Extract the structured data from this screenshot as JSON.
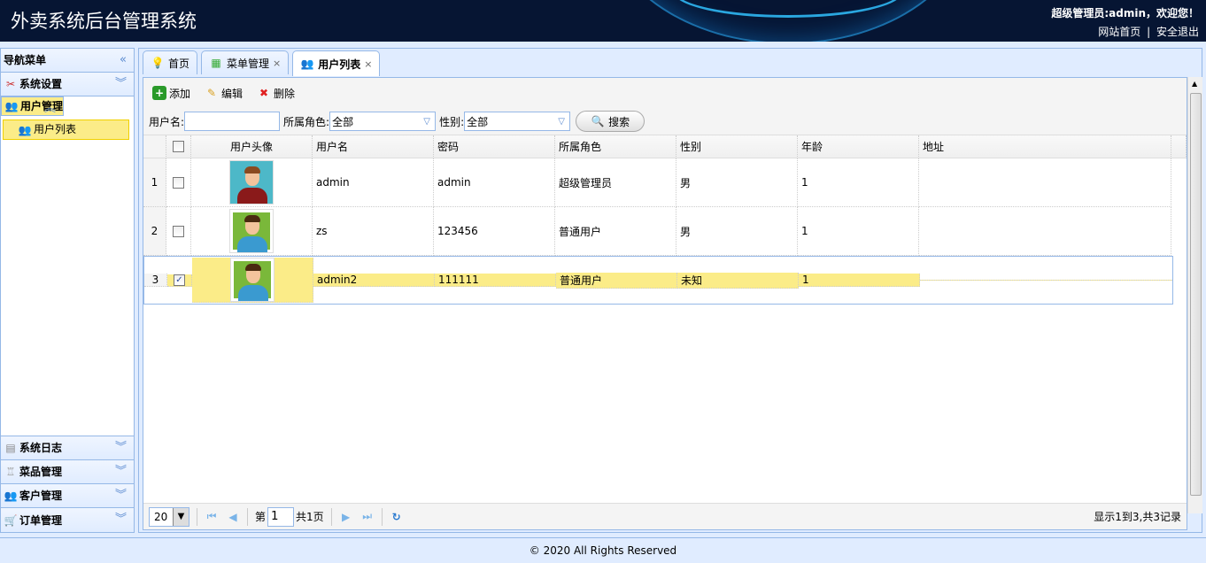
{
  "header": {
    "title": "外卖系统后台管理系统",
    "welcome": "超级管理员:admin，欢迎您！",
    "home_link": "网站首页",
    "separator": "|",
    "logout_link": "安全退出"
  },
  "sidebar": {
    "title": "导航菜单",
    "sections": [
      {
        "label": "系统设置"
      },
      {
        "label": "用户管理",
        "items": [
          {
            "label": "用户列表"
          }
        ]
      },
      {
        "label": "系统日志"
      },
      {
        "label": "菜品管理"
      },
      {
        "label": "客户管理"
      },
      {
        "label": "订单管理"
      }
    ]
  },
  "tabs": [
    {
      "label": "首页"
    },
    {
      "label": "菜单管理",
      "close": "×"
    },
    {
      "label": "用户列表",
      "close": "×"
    }
  ],
  "toolbar": {
    "add": "添加",
    "edit": "编辑",
    "delete": "删除"
  },
  "search": {
    "username_label": "用户名:",
    "username_value": "",
    "role_label": "所属角色:",
    "role_value": "全部",
    "gender_label": "性别:",
    "gender_value": "全部",
    "search_button": "搜索"
  },
  "grid": {
    "columns": [
      "用户头像",
      "用户名",
      "密码",
      "所属角色",
      "性别",
      "年龄",
      "地址"
    ],
    "rows": [
      {
        "num": "1",
        "checked": false,
        "username": "admin",
        "password": "admin",
        "role": "超级管理员",
        "gender": "男",
        "age": "1",
        "address": ""
      },
      {
        "num": "2",
        "checked": false,
        "username": "zs",
        "password": "123456",
        "role": "普通用户",
        "gender": "男",
        "age": "1",
        "address": ""
      },
      {
        "num": "3",
        "checked": true,
        "username": "admin2",
        "password": "111111",
        "role": "普通用户",
        "gender": "未知",
        "age": "1",
        "address": ""
      }
    ]
  },
  "pager": {
    "page_size": "20",
    "page_prefix": "第",
    "page": "1",
    "page_suffix": "共1页",
    "info": "显示1到3,共3记录"
  },
  "footer": {
    "copyright": "© 2020 All Rights Reserved"
  }
}
